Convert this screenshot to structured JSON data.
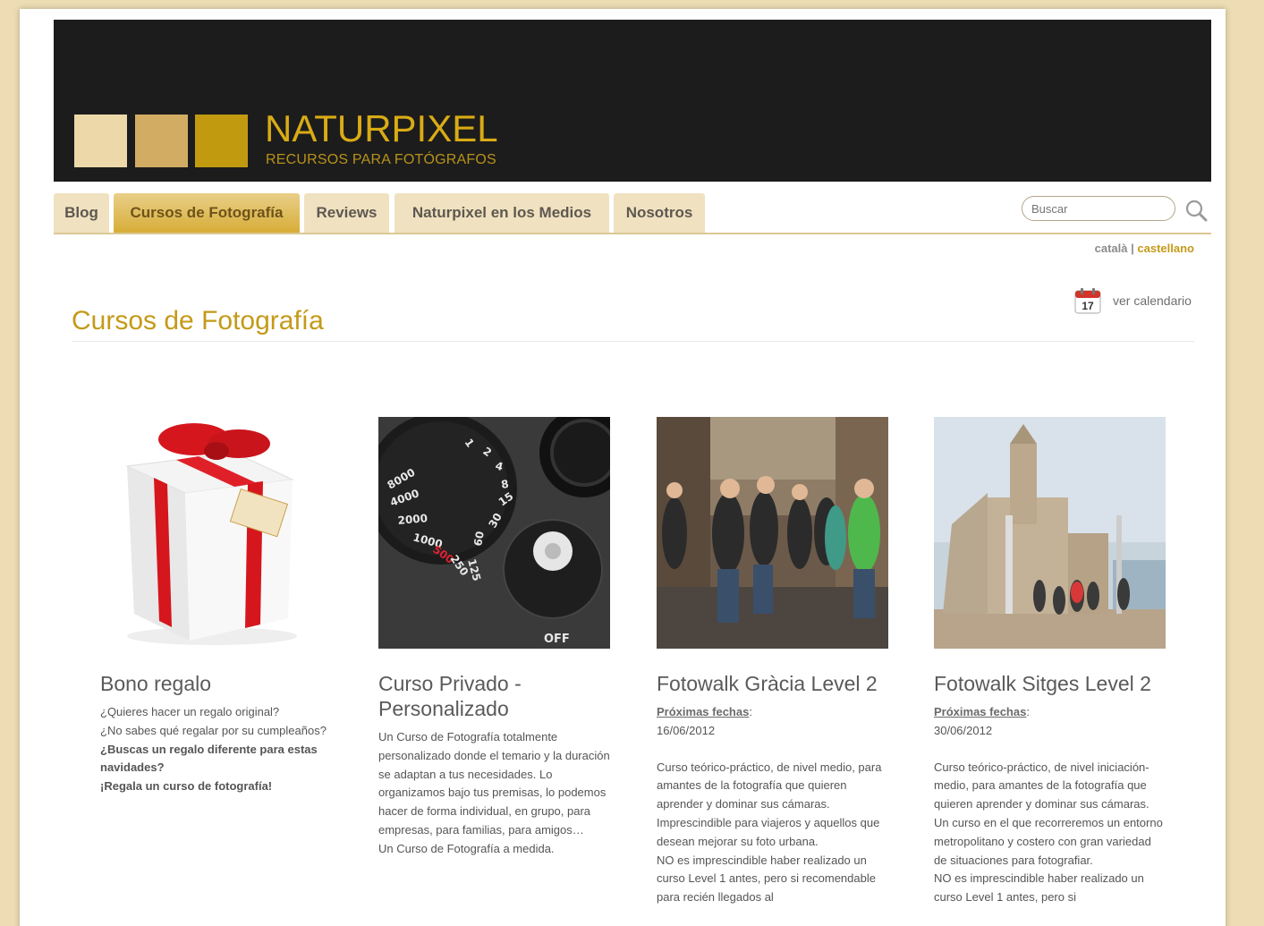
{
  "brand": {
    "name": "NATURPIXEL",
    "tagline": "RECURSOS PARA FOTÓGRAFOS",
    "colors": {
      "light": "#ecd8a9",
      "mid": "#d2ac63",
      "dark": "#c29a10"
    }
  },
  "nav": {
    "tabs": [
      {
        "label": "Blog"
      },
      {
        "label": "Cursos de Fotografía",
        "active": true
      },
      {
        "label": "Reviews"
      },
      {
        "label": "Naturpixel en los Medios"
      },
      {
        "label": "Nosotros"
      }
    ]
  },
  "search": {
    "placeholder": "Buscar"
  },
  "lang": {
    "ca": "català",
    "sep": "|",
    "es": "castellano",
    "active": "castellano"
  },
  "calendar": {
    "icon_day": "17",
    "link": "ver calendario"
  },
  "page": {
    "title": "Cursos de Fotografía"
  },
  "cards": [
    {
      "title": "Bono regalo",
      "image": "gift-box",
      "lines": [
        "¿Quieres hacer un regalo original?",
        "¿No sabes qué regalar por su cumpleaños?",
        "¿Buscas un regalo diferente para estas navidades?",
        "¡Regala un curso de fotografía!"
      ],
      "emph": [
        "qué regalar por su cumpleaños?",
        "un regalo diferente para estas navidades?"
      ]
    },
    {
      "title": "Curso Privado - Personalizado",
      "image": "camera-dial",
      "body": "Un Curso de Fotografía totalmente personalizado donde el temario y la duración se adaptan a tus necesidades. Lo organizamos bajo tus premisas, lo podemos hacer de forma individual, en grupo, para empresas, para familias, para amigos…",
      "footer": "Un Curso de Fotografía a medida.",
      "dial_numbers": [
        "8000",
        "4000",
        "2000",
        "1000",
        "500",
        "250",
        "125",
        "60",
        "30",
        "15",
        "8",
        "4",
        "2",
        "1"
      ],
      "dial_off": "OFF"
    },
    {
      "title": "Fotowalk Gràcia Level 2",
      "image": "street-group",
      "dates_label": "Próximas fechas",
      "date": "16/06/2012",
      "body": "Curso teórico-práctico, de nivel medio, para amantes de la fotografía que quieren aprender y dominar sus cámaras. Imprescindible para viajeros y aquellos que desean mejorar su foto urbana.",
      "body2": "NO es imprescindible haber realizado un curso Level 1 antes, pero si recomendable para recién llegados al"
    },
    {
      "title": "Fotowalk Sitges Level 2",
      "image": "church-seafront",
      "dates_label": "Próximas fechas",
      "date": "30/06/2012",
      "body": "Curso teórico-práctico, de nivel iniciación-medio, para amantes de la fotografía que quieren aprender y dominar sus cámaras. Un curso en el que recorreremos un entorno metropolitano y costero con gran variedad de situaciones para fotografiar.",
      "body2": "NO es imprescindible haber realizado un curso Level 1 antes, pero si"
    }
  ]
}
